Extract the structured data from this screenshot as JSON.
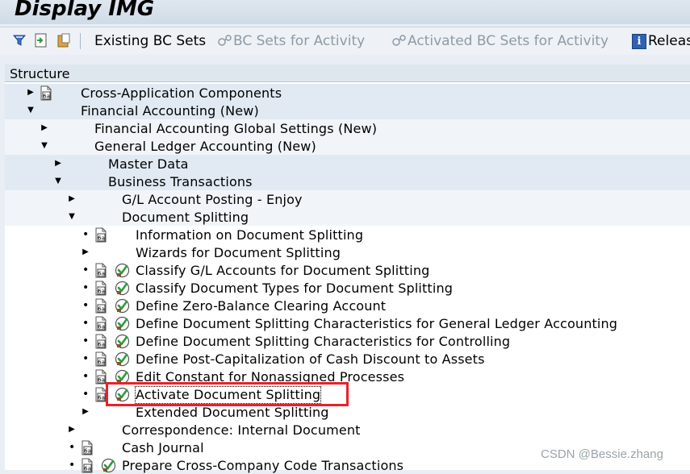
{
  "window": {
    "title": "Display IMG"
  },
  "toolbar": {
    "existing_bc_sets": "Existing BC Sets",
    "bc_sets_for_activity": "BC Sets for Activity",
    "activated_bc_sets": "Activated BC Sets for Activity",
    "release_notes": "Release"
  },
  "tree": {
    "header": "Structure",
    "items": [
      {
        "label": "Cross-Application Components"
      },
      {
        "label": "Financial Accounting (New)"
      },
      {
        "label": "Financial Accounting Global Settings (New)"
      },
      {
        "label": "General Ledger Accounting (New)"
      },
      {
        "label": "Master Data"
      },
      {
        "label": "Business Transactions"
      },
      {
        "label": "G/L Account Posting - Enjoy"
      },
      {
        "label": "Document Splitting"
      },
      {
        "label": "Information on Document Splitting"
      },
      {
        "label": "Wizards for Document Splitting"
      },
      {
        "label": "Classify G/L Accounts for Document Splitting"
      },
      {
        "label": "Classify Document Types for Document Splitting"
      },
      {
        "label": "Define Zero-Balance Clearing Account"
      },
      {
        "label": "Define Document Splitting Characteristics for General Ledger Accounting"
      },
      {
        "label": "Define Document Splitting Characteristics for Controlling"
      },
      {
        "label": "Define Post-Capitalization of Cash Discount to Assets"
      },
      {
        "label": "Edit Constant for Nonassigned Processes"
      },
      {
        "label": "Activate Document Splitting"
      },
      {
        "label": "Extended Document Splitting"
      },
      {
        "label": "Correspondence: Internal Document"
      },
      {
        "label": "Cash Journal"
      },
      {
        "label": "Prepare Cross-Company Code Transactions"
      }
    ]
  },
  "watermark": "CSDN @Bessie.zhang",
  "colors": {
    "highlight": "#e8212a",
    "row_blue": "#e1eaf2",
    "exec_green": "#2e9b3a"
  }
}
